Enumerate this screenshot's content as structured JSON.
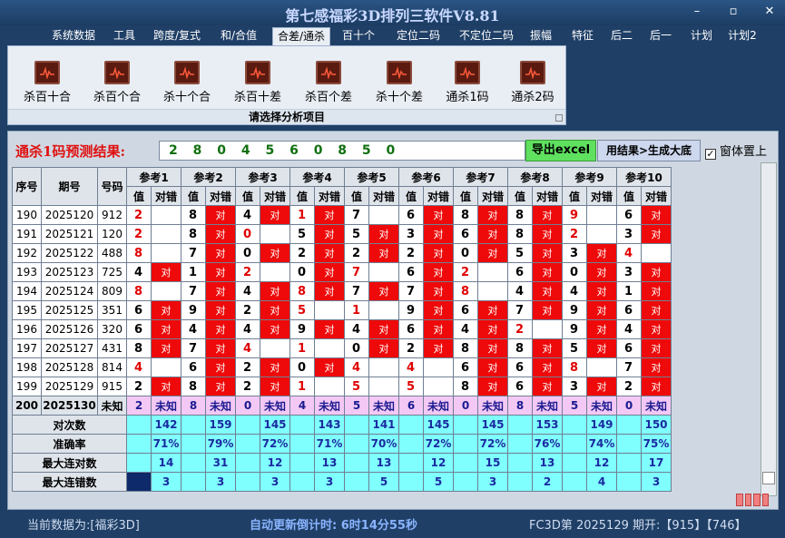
{
  "window": {
    "title": "第七感福彩3D排列三软件V8.81"
  },
  "menu": {
    "items": [
      "系统数据",
      "工具",
      "跨度/复式",
      "和/合值",
      "合差/通杀",
      "百十个",
      "定位二码",
      "不定位二码",
      "振幅",
      "特征",
      "后二",
      "后一",
      "计划",
      "计划2"
    ],
    "active": "合差/通杀"
  },
  "ribbon": {
    "buttons": [
      "杀百十合",
      "杀百个合",
      "杀十个合",
      "杀百十差",
      "杀百个差",
      "杀十个差",
      "通杀1码",
      "通杀2码"
    ],
    "caption": "请选择分析项目"
  },
  "prediction": {
    "label": "通杀1码预测结果:",
    "value": "2 8 0 4 5 6 0 8 5 0",
    "export_label": "导出excel",
    "generate_label": "用结果>生成大底",
    "ontop_label": "窗体置上",
    "ontop_checked": "✓"
  },
  "table": {
    "headers": {
      "seq": "序号",
      "period": "期号",
      "number": "号码",
      "value": "值",
      "result": "对错"
    },
    "refs": [
      "参考1",
      "参考2",
      "参考3",
      "参考4",
      "参考5",
      "参考6",
      "参考7",
      "参考8",
      "参考9",
      "参考10"
    ],
    "rows": [
      {
        "seq": "190",
        "period": "2025120",
        "num": "912",
        "vals": [
          "2",
          "8",
          "4",
          "1",
          "7",
          "6",
          "8",
          "8",
          "9",
          "6"
        ],
        "hit": [
          0,
          1,
          1,
          1,
          0,
          1,
          1,
          1,
          0,
          1
        ],
        "red": [
          1,
          0,
          0,
          1,
          0,
          0,
          0,
          0,
          1,
          0
        ]
      },
      {
        "seq": "191",
        "period": "2025121",
        "num": "120",
        "vals": [
          "2",
          "8",
          "0",
          "5",
          "5",
          "3",
          "6",
          "8",
          "2",
          "3"
        ],
        "hit": [
          0,
          1,
          0,
          1,
          1,
          1,
          1,
          1,
          0,
          1
        ],
        "red": [
          1,
          0,
          1,
          0,
          0,
          0,
          0,
          0,
          1,
          0
        ]
      },
      {
        "seq": "192",
        "period": "2025122",
        "num": "488",
        "vals": [
          "8",
          "7",
          "0",
          "2",
          "2",
          "2",
          "0",
          "5",
          "3",
          "4"
        ],
        "hit": [
          0,
          1,
          1,
          1,
          1,
          1,
          1,
          1,
          1,
          0
        ],
        "red": [
          1,
          0,
          0,
          0,
          0,
          0,
          0,
          0,
          0,
          1
        ]
      },
      {
        "seq": "193",
        "period": "2025123",
        "num": "725",
        "vals": [
          "4",
          "1",
          "2",
          "0",
          "7",
          "6",
          "2",
          "6",
          "0",
          "3"
        ],
        "hit": [
          1,
          1,
          0,
          1,
          0,
          1,
          0,
          1,
          1,
          1
        ],
        "red": [
          0,
          0,
          1,
          0,
          1,
          0,
          1,
          0,
          0,
          0
        ]
      },
      {
        "seq": "194",
        "period": "2025124",
        "num": "809",
        "vals": [
          "8",
          "7",
          "4",
          "8",
          "7",
          "7",
          "8",
          "4",
          "4",
          "1"
        ],
        "hit": [
          0,
          1,
          1,
          1,
          1,
          1,
          0,
          1,
          1,
          1
        ],
        "red": [
          1,
          0,
          0,
          1,
          0,
          0,
          1,
          0,
          0,
          0
        ]
      },
      {
        "seq": "195",
        "period": "2025125",
        "num": "351",
        "vals": [
          "6",
          "9",
          "2",
          "5",
          "1",
          "9",
          "6",
          "7",
          "9",
          "6"
        ],
        "hit": [
          1,
          1,
          1,
          0,
          0,
          1,
          1,
          1,
          1,
          1
        ],
        "red": [
          0,
          0,
          0,
          1,
          1,
          0,
          0,
          0,
          0,
          0
        ]
      },
      {
        "seq": "196",
        "period": "2025126",
        "num": "320",
        "vals": [
          "6",
          "4",
          "4",
          "9",
          "4",
          "6",
          "4",
          "2",
          "9",
          "4"
        ],
        "hit": [
          1,
          1,
          1,
          1,
          1,
          1,
          1,
          0,
          1,
          1
        ],
        "red": [
          0,
          0,
          0,
          0,
          0,
          0,
          0,
          1,
          0,
          0
        ]
      },
      {
        "seq": "197",
        "period": "2025127",
        "num": "431",
        "vals": [
          "8",
          "7",
          "4",
          "1",
          "0",
          "2",
          "8",
          "8",
          "5",
          "6"
        ],
        "hit": [
          1,
          1,
          0,
          0,
          1,
          1,
          1,
          1,
          1,
          1
        ],
        "red": [
          0,
          0,
          1,
          1,
          0,
          0,
          0,
          0,
          0,
          0
        ]
      },
      {
        "seq": "198",
        "period": "2025128",
        "num": "814",
        "vals": [
          "4",
          "6",
          "2",
          "0",
          "4",
          "4",
          "6",
          "6",
          "8",
          "7"
        ],
        "hit": [
          0,
          1,
          1,
          1,
          0,
          0,
          1,
          1,
          0,
          1
        ],
        "red": [
          1,
          0,
          0,
          0,
          1,
          1,
          0,
          0,
          1,
          0
        ]
      },
      {
        "seq": "199",
        "period": "2025129",
        "num": "915",
        "vals": [
          "2",
          "8",
          "2",
          "1",
          "5",
          "5",
          "8",
          "6",
          "3",
          "2"
        ],
        "hit": [
          1,
          1,
          1,
          0,
          0,
          0,
          1,
          1,
          1,
          1
        ],
        "red": [
          0,
          0,
          0,
          1,
          1,
          1,
          0,
          0,
          0,
          0
        ]
      }
    ],
    "pred_row": {
      "seq": "200",
      "period": "2025130",
      "num": "未知",
      "vals": [
        "2",
        "8",
        "0",
        "4",
        "5",
        "6",
        "0",
        "8",
        "5",
        "0"
      ],
      "unknown": "未知"
    },
    "stats": [
      {
        "label": "对次数",
        "values": [
          "142",
          "159",
          "145",
          "143",
          "141",
          "145",
          "145",
          "153",
          "149",
          "150"
        ]
      },
      {
        "label": "准确率",
        "values": [
          "71%",
          "79%",
          "72%",
          "71%",
          "70%",
          "72%",
          "72%",
          "76%",
          "74%",
          "75%"
        ]
      },
      {
        "label": "最大连对数",
        "values": [
          "14",
          "31",
          "12",
          "13",
          "13",
          "12",
          "15",
          "13",
          "12",
          "17"
        ]
      },
      {
        "label": "最大连错数",
        "values": [
          "3",
          "3",
          "3",
          "3",
          "5",
          "5",
          "3",
          "2",
          "4",
          "3"
        ]
      }
    ],
    "hit_mark": "对"
  },
  "status": {
    "left": "当前数据为:[福彩3D]",
    "countdown": "自动更新倒计时:  6时14分55秒",
    "right": "FC3D第 2025129 期开:【915】【746】"
  },
  "colors": {
    "hit_red": "#ee0a0a",
    "stat_cyan": "#80ffff",
    "pred_pink": "#f4c8f4",
    "title_blue": "#c9d8ff"
  }
}
